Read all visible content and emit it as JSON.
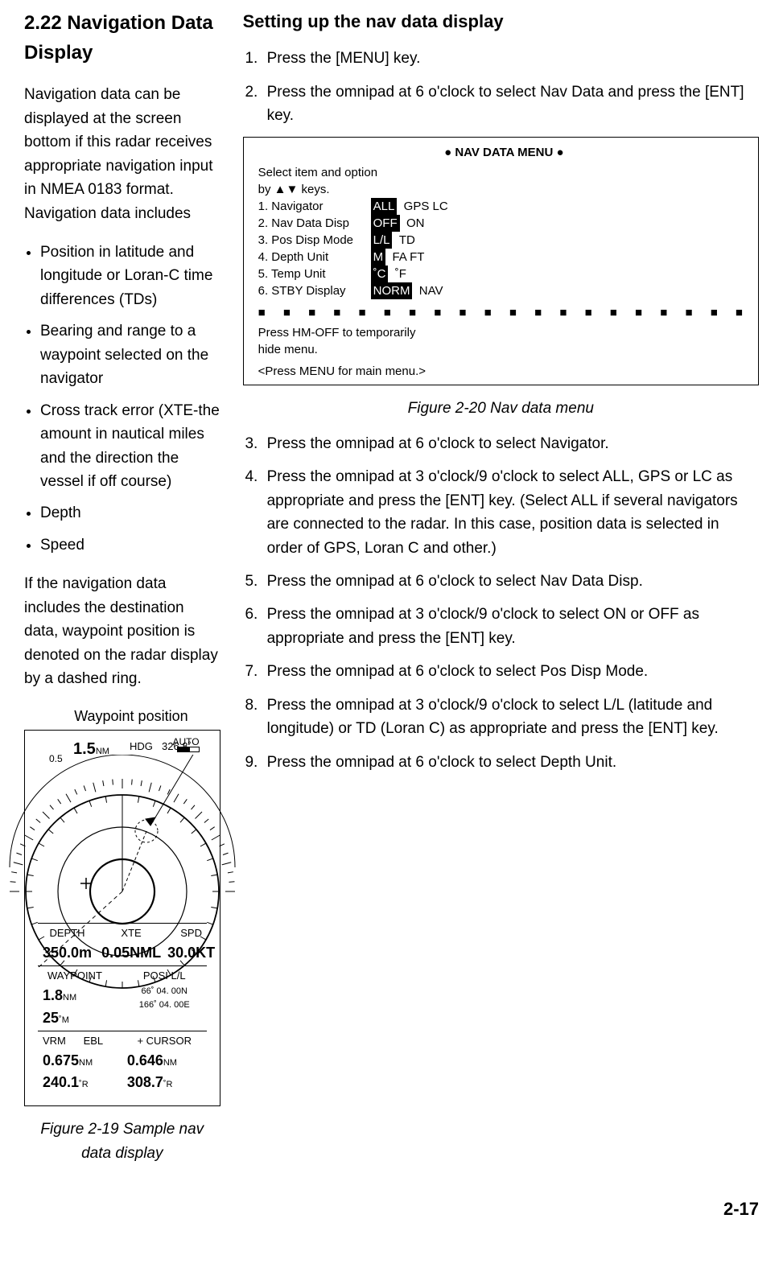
{
  "left": {
    "heading": "2.22 Navigation Data Display",
    "intro": "Navigation data can be displayed at the screen bottom if this radar receives appropriate navigation input in NMEA 0183 format. Navigation data includes",
    "bullets": [
      "Position in latitude and longitude or Loran-C time differences (TDs)",
      "Bearing and range to a waypoint selected on the navigator",
      "Cross track error (XTE-the amount in nautical miles and the direction the vessel if off course)",
      "Depth",
      "Speed"
    ],
    "after": "If the navigation data includes the destination data, waypoint position is denoted on the radar display by a dashed ring.",
    "waypoint_label": "Waypoint position",
    "radar": {
      "range_main": "1.5",
      "range_unit": "NM",
      "sub_range": "0.5",
      "hdg_label": "HDG",
      "hdg_value": "326.8˚",
      "auto": "AUTO",
      "depth_label": "DEPTH",
      "depth_value": "350.0m",
      "xte_label": "XTE",
      "xte_value": "0.05NML",
      "spd_label": "SPD",
      "spd_value": "30.0KT",
      "waypoint_label": "WAYPOINT",
      "wp_dist": "1.8",
      "wp_dist_u": "NM",
      "wp_brg": "25",
      "wp_brg_u": "˚M",
      "posi_label": "POSI L/L",
      "posi_lat": "66˚ 04. 00N",
      "posi_lon": "166˚ 04. 00E",
      "vrm_label": "VRM",
      "vrm_value": "0.675",
      "vrm_u": "NM",
      "ebl_label": "EBL",
      "ebl_value": "240.1",
      "ebl_u": "˚R",
      "cursor_label": "+ CURSOR",
      "cursor_rng": "0.646",
      "cursor_rng_u": "NM",
      "cursor_brg": "308.7",
      "cursor_brg_u": "˚R"
    },
    "fig19": "Figure 2-19 Sample nav data display"
  },
  "right": {
    "heading": "Setting up the nav data display",
    "steps_a": [
      "Press the [MENU] key.",
      "Press the omnipad at 6 o'clock to select Nav Data and press the [ENT] key."
    ],
    "menu": {
      "title": "● NAV DATA MENU ●",
      "hint1": "Select item and option",
      "hint2": "by ▲▼ keys.",
      "rows": [
        {
          "name": "1. Navigator",
          "sel": "ALL",
          "opts": "GPS   LC"
        },
        {
          "name": "2. Nav Data Disp",
          "sel": "OFF",
          "opts": "ON"
        },
        {
          "name": "3. Pos Disp Mode",
          "sel": "L/L",
          "opts": "TD"
        },
        {
          "name": "4. Depth Unit",
          "sel": "M",
          "opts": "FA   FT"
        },
        {
          "name": "5. Temp Unit",
          "sel": "˚C",
          "opts": "˚F"
        },
        {
          "name": "6. STBY Display",
          "sel": "NORM",
          "opts": "NAV"
        }
      ],
      "foot1": "Press HM-OFF to temporarily",
      "foot2": "hide menu.",
      "bracket": "<Press MENU for main menu.>"
    },
    "fig20": "Figure 2-20 Nav data menu",
    "steps_b": [
      "Press the omnipad at 6 o'clock to select Navigator.",
      "Press the omnipad at 3 o'clock/9 o'clock to select ALL, GPS or LC as appropriate and press the [ENT] key. (Select ALL if several navigators are connected to the radar. In this case, position data is selected in order of GPS, Loran C and other.)",
      "Press the omnipad at 6 o'clock to select Nav Data Disp.",
      "Press the omnipad at 3 o'clock/9 o'clock to select ON or OFF as appropriate and press the [ENT] key.",
      "Press the omnipad at 6 o'clock to select Pos Disp Mode.",
      "Press the omnipad at 3 o'clock/9 o'clock to select L/L (latitude and longitude) or TD (Loran C) as appropriate and press the [ENT] key.",
      "Press the omnipad at 6 o'clock to select Depth Unit."
    ]
  },
  "pagenum": "2-17"
}
